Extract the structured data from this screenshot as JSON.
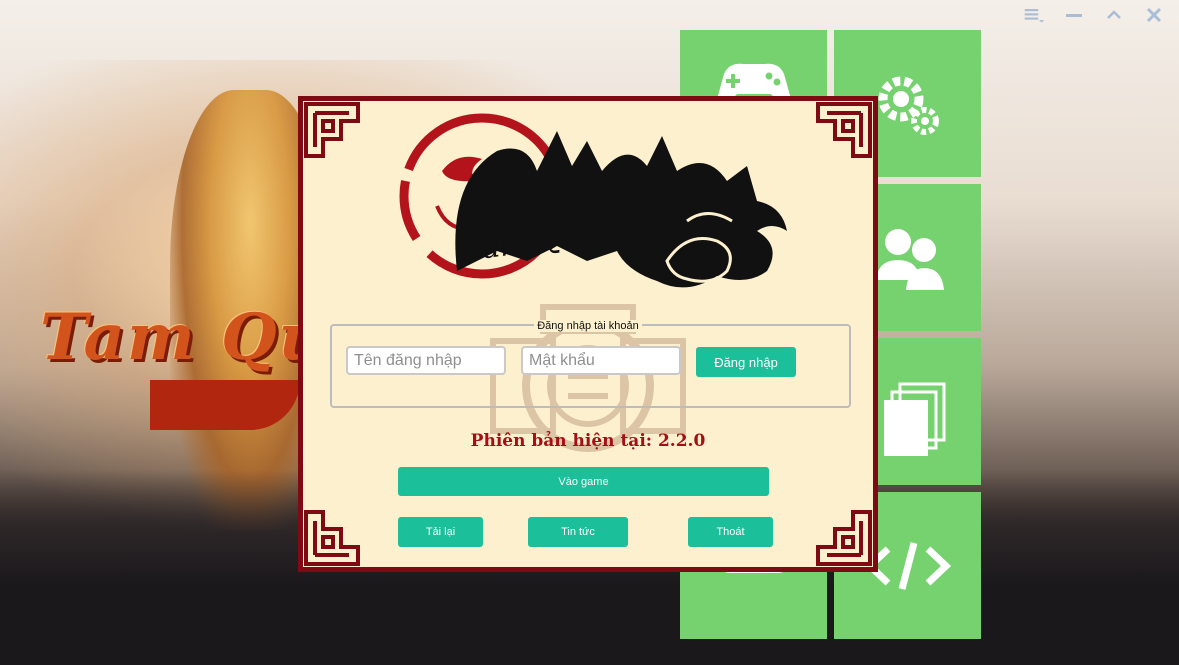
{
  "background": {
    "title_text": "Tam Quố"
  },
  "window_controls": {
    "menu_icon": "menu-icon",
    "minimize_icon": "minimize-icon",
    "collapse_icon": "chevron-up-icon",
    "close_icon": "close-icon"
  },
  "tiles": [
    {
      "icon": "gamepad-icon"
    },
    {
      "icon": "gears-icon"
    },
    {
      "icon": "users-icon"
    },
    {
      "icon": "pages-icon"
    },
    {
      "icon": "youtube-play-icon"
    },
    {
      "icon": "code-icon"
    }
  ],
  "dialog": {
    "logo_text": "Tam Quốc Sát",
    "login": {
      "legend": "Đăng nhập tài khoản",
      "username_placeholder": "Tên đăng nhập",
      "password_placeholder": "Mật khẩu",
      "login_button": "Đăng nhập"
    },
    "version_text": "Phiên bản hiện tại: 2.2.0",
    "play_button": "Vào game",
    "reload_button": "Tải lại",
    "news_button": "Tin tức",
    "exit_button": "Thoát"
  },
  "colors": {
    "tile_green": "#76d26f",
    "button_teal": "#1bbf99",
    "frame_red": "#7e0b13",
    "version_red": "#a50f14",
    "dialog_bg": "#fdf0cf"
  }
}
